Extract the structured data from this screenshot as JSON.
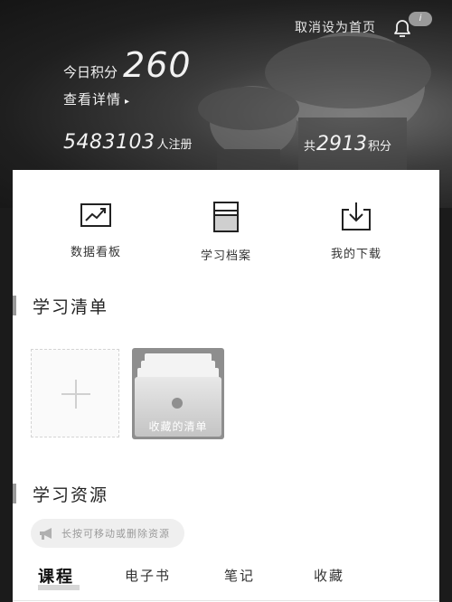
{
  "header": {
    "set_home_label": "取消设为首页",
    "notification_badge": "i",
    "points_label": "今日积分",
    "points_value": "260",
    "details_label": "查看详情",
    "details_arrow": "▸",
    "registered_count": "5483103",
    "registered_label": "人注册",
    "total_prefix": "共",
    "total_points": "2913",
    "total_suffix": "积分"
  },
  "quick_actions": [
    {
      "label": "数据看板",
      "icon": "chart-trend-icon"
    },
    {
      "label": "学习档案",
      "icon": "folder-archive-icon"
    },
    {
      "label": "我的下载",
      "icon": "download-tray-icon"
    }
  ],
  "study_list": {
    "title": "学习清单",
    "add_icon": "plus-icon",
    "favorites_label": "收藏的清单"
  },
  "resources": {
    "title": "学习资源",
    "hint_icon": "megaphone-icon",
    "hint_text": "长按可移动或删除资源",
    "tabs": [
      {
        "label": "课程",
        "active": true
      },
      {
        "label": "电子书",
        "active": false
      },
      {
        "label": "笔记",
        "active": false
      },
      {
        "label": "收藏",
        "active": false
      }
    ]
  },
  "colors": {
    "header_dark": "#1f1f1f",
    "card_bg": "#ffffff",
    "accent_gray": "#999999",
    "text_dark": "#222222"
  }
}
